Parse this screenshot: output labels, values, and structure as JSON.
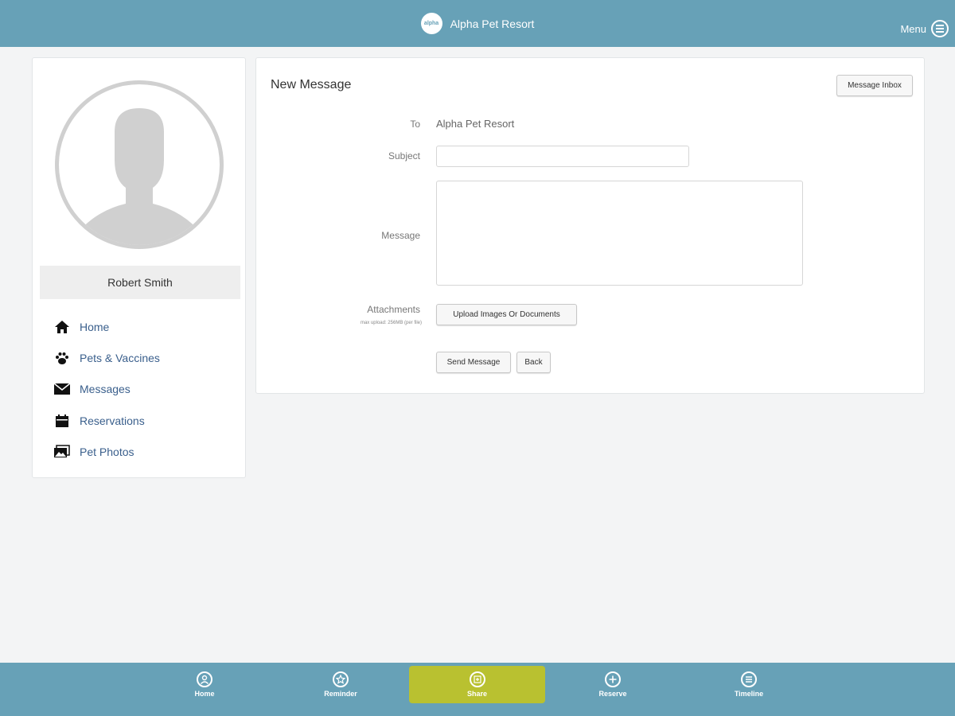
{
  "header": {
    "logo_text": "alpha",
    "app_name": "Alpha Pet Resort",
    "menu_label": "Menu",
    "bar_color": "#67a1b7"
  },
  "sidebar": {
    "user_name": "Robert Smith",
    "items": [
      {
        "label": "Home",
        "icon": "home-icon"
      },
      {
        "label": "Pets & Vaccines",
        "icon": "paw-icon"
      },
      {
        "label": "Messages",
        "icon": "envelope-icon"
      },
      {
        "label": "Reservations",
        "icon": "calendar-icon"
      },
      {
        "label": "Pet Photos",
        "icon": "photos-icon"
      }
    ],
    "link_color": "#3a5f8c"
  },
  "form": {
    "title": "New Message",
    "inbox_button": "Message Inbox",
    "to_label": "To",
    "to_value": "Alpha Pet Resort",
    "subject_label": "Subject",
    "subject_value": "",
    "message_label": "Message",
    "message_value": "",
    "attachments_label": "Attachments",
    "attachments_note": "max upload: 256MB (per file)",
    "upload_button": "Upload Images Or Documents",
    "send_button": "Send Message",
    "back_button": "Back"
  },
  "bottom_nav": {
    "tabs": [
      {
        "label": "Home",
        "icon": "user-circle-icon",
        "active": false
      },
      {
        "label": "Reminder",
        "icon": "star-icon",
        "active": false
      },
      {
        "label": "Share",
        "icon": "share-icon",
        "active": true
      },
      {
        "label": "Reserve",
        "icon": "plus-icon",
        "active": false
      },
      {
        "label": "Timeline",
        "icon": "timeline-icon",
        "active": false
      }
    ],
    "active_color": "#b9c130"
  }
}
